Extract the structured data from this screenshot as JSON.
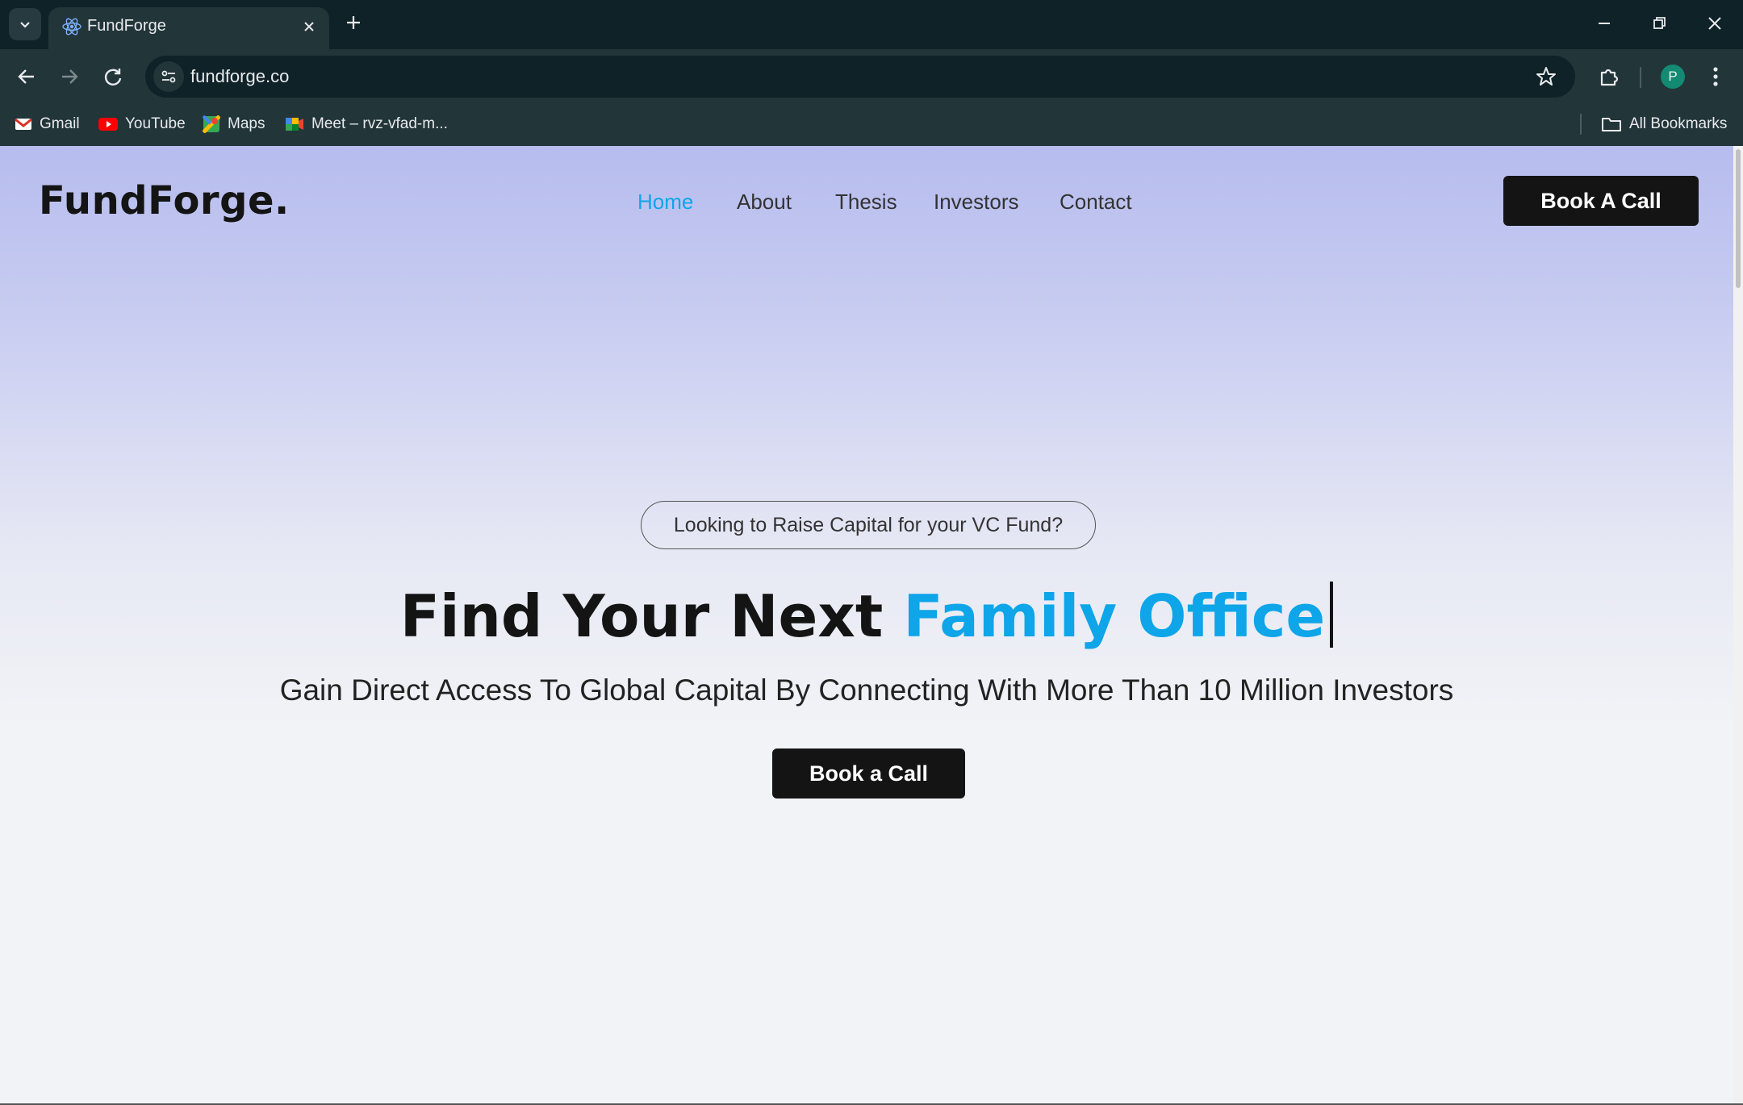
{
  "browser": {
    "tab": {
      "title": "FundForge",
      "favicon": "react-atom-icon"
    },
    "address": {
      "url": "fundforge.co"
    },
    "profile_initial": "P",
    "bookmarks": [
      {
        "label": "Gmail",
        "icon": "gmail-icon"
      },
      {
        "label": "YouTube",
        "icon": "youtube-icon"
      },
      {
        "label": "Maps",
        "icon": "maps-icon"
      },
      {
        "label": "Meet – rvz-vfad-m...",
        "icon": "meet-icon"
      }
    ],
    "all_bookmarks_label": "All Bookmarks"
  },
  "site": {
    "logo": "FundForge.",
    "nav": [
      {
        "label": "Home",
        "active": true
      },
      {
        "label": "About",
        "active": false
      },
      {
        "label": "Thesis",
        "active": false
      },
      {
        "label": "Investors",
        "active": false
      },
      {
        "label": "Contact",
        "active": false
      }
    ],
    "header_cta": "Book A Call",
    "hero": {
      "eyebrow": "Looking to Raise Capital for your VC Fund?",
      "headline_prefix": "Find Your Next ",
      "headline_highlight": "Family Office",
      "subtitle": "Gain Direct Access To Global Capital By Connecting With More Than 10 Million Investors",
      "cta": "Book a Call"
    }
  },
  "colors": {
    "accent": "#0ea5e9",
    "button_bg": "#141414",
    "gradient_top": "#b6bcee",
    "page_bg": "#f2f3f6",
    "chrome_dark": "#0e2227",
    "chrome_toolbar": "#223539"
  }
}
